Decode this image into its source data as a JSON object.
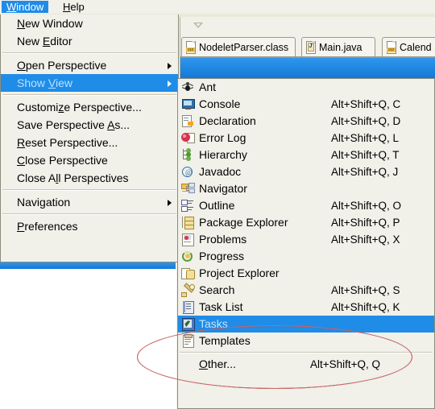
{
  "app": {
    "menubar": [
      {
        "label": "Window",
        "selected": true
      },
      {
        "label": "Help",
        "selected": false
      }
    ],
    "editor_tabs": [
      {
        "label": "NodeletParser.class",
        "icon": "class-file-icon"
      },
      {
        "label": "Main.java",
        "icon": "java-file-icon"
      },
      {
        "label": "Calend",
        "icon": "class-file-icon"
      }
    ]
  },
  "window_menu": {
    "items": [
      {
        "label": "New Window",
        "mnemonic": "N",
        "type": "item"
      },
      {
        "label": "New Editor",
        "mnemonic": "E",
        "type": "item"
      },
      {
        "type": "separator"
      },
      {
        "label": "Open Perspective",
        "mnemonic": "O",
        "type": "submenu"
      },
      {
        "label": "Show View",
        "mnemonic": "V",
        "type": "submenu",
        "highlighted": true
      },
      {
        "type": "separator"
      },
      {
        "label": "Customize Perspective...",
        "mnemonic": "z",
        "type": "item"
      },
      {
        "label": "Save Perspective As...",
        "mnemonic": "A",
        "type": "item"
      },
      {
        "label": "Reset Perspective...",
        "mnemonic": "R",
        "type": "item"
      },
      {
        "label": "Close Perspective",
        "mnemonic": "C",
        "type": "item"
      },
      {
        "label": "Close All Perspectives",
        "mnemonic": "l",
        "type": "item"
      },
      {
        "type": "separator"
      },
      {
        "label": "Navigation",
        "mnemonic": "g",
        "type": "submenu"
      },
      {
        "type": "separator"
      },
      {
        "label": "Preferences",
        "mnemonic": "P",
        "type": "item"
      }
    ]
  },
  "show_view_submenu": {
    "items": [
      {
        "label": "Ant",
        "shortcut": "",
        "icon": "ant-icon"
      },
      {
        "label": "Console",
        "shortcut": "Alt+Shift+Q, C",
        "icon": "console-icon"
      },
      {
        "label": "Declaration",
        "shortcut": "Alt+Shift+Q, D",
        "icon": "declaration-icon"
      },
      {
        "label": "Error Log",
        "shortcut": "Alt+Shift+Q, L",
        "icon": "error-log-icon"
      },
      {
        "label": "Hierarchy",
        "shortcut": "Alt+Shift+Q, T",
        "icon": "hierarchy-icon"
      },
      {
        "label": "Javadoc",
        "shortcut": "Alt+Shift+Q, J",
        "icon": "javadoc-icon"
      },
      {
        "label": "Navigator",
        "shortcut": "",
        "icon": "navigator-icon"
      },
      {
        "label": "Outline",
        "shortcut": "Alt+Shift+Q, O",
        "icon": "outline-icon"
      },
      {
        "label": "Package Explorer",
        "shortcut": "Alt+Shift+Q, P",
        "icon": "package-explorer-icon"
      },
      {
        "label": "Problems",
        "shortcut": "Alt+Shift+Q, X",
        "icon": "problems-icon"
      },
      {
        "label": "Progress",
        "shortcut": "",
        "icon": "progress-icon"
      },
      {
        "label": "Project Explorer",
        "shortcut": "",
        "icon": "project-explorer-icon"
      },
      {
        "label": "Search",
        "shortcut": "Alt+Shift+Q, S",
        "icon": "search-icon"
      },
      {
        "label": "Task List",
        "shortcut": "Alt+Shift+Q, K",
        "icon": "task-list-icon"
      },
      {
        "label": "Tasks",
        "shortcut": "",
        "icon": "tasks-icon",
        "highlighted": true
      },
      {
        "label": "Templates",
        "shortcut": "",
        "icon": "templates-icon"
      }
    ],
    "other": {
      "label": "Other...",
      "mnemonic": "O",
      "shortcut": "Alt+Shift+Q, Q"
    }
  },
  "annotation": {
    "shape": "ellipse",
    "color": "#b03a3a",
    "targets": [
      "Task List",
      "Tasks",
      "Templates"
    ]
  },
  "colors": {
    "menu_background": "#f1f0e9",
    "highlight": "#1f8ce8",
    "highlight_text": "#c3e6ff",
    "annotation_red": "#b03a3a"
  }
}
